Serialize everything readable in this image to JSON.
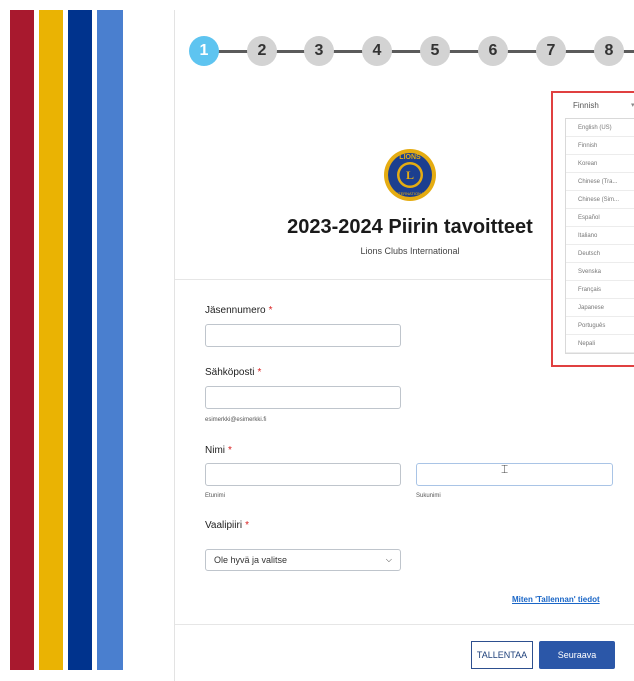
{
  "steps": [
    "1",
    "2",
    "3",
    "4",
    "5",
    "6",
    "7",
    "8"
  ],
  "header": {
    "title": "2023-2024 Piirin tavoitteet",
    "subtitle": "Lions Clubs International",
    "logo_text_top": "LIONS",
    "logo_text_bottom": "INTERNATIONAL",
    "logo_letter": "L"
  },
  "form": {
    "member_number_label": "Jäsennumero",
    "email_label": "Sähköposti",
    "email_hint": "esimerkki@esimerkki.fi",
    "name_label": "Nimi",
    "first_name_hint": "Etunimi",
    "last_name_hint": "Sukunimi",
    "district_label": "Vaalipiiri",
    "district_value": "Ole hyvä ja valitse",
    "required_mark": "*"
  },
  "save_info_link": "Miten 'Tallennan' tiedot",
  "buttons": {
    "save": "TALLENTAA",
    "next": "Seuraava"
  },
  "language": {
    "current": "Finnish",
    "options": [
      "English (US)",
      "Finnish",
      "Korean",
      "Chinese (Tra...",
      "Chinese (Sim...",
      "Español",
      "Italiano",
      "Deutsch",
      "Svenska",
      "Français",
      "Japanese",
      "Português",
      "Nepali"
    ]
  },
  "colors": {
    "stripe_red": "#a8192e",
    "stripe_yellow": "#eab303",
    "stripe_navy": "#00338d",
    "stripe_blue": "#4a7fcf",
    "active_step": "#5ec4f0",
    "primary_button": "#2b57a8",
    "highlight_border": "#e04040"
  }
}
